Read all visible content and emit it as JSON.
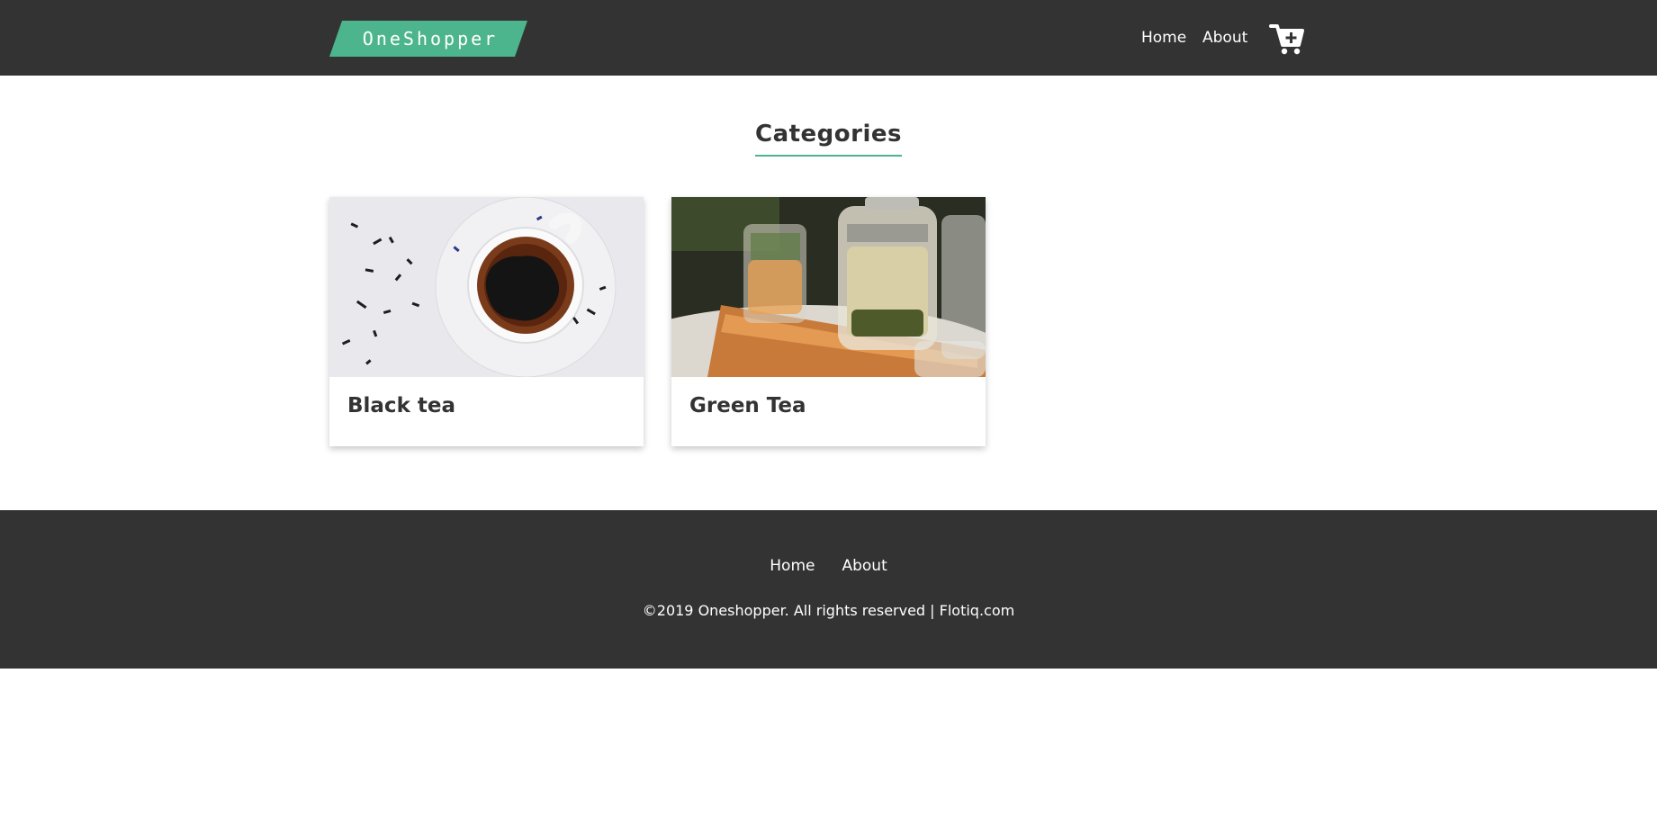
{
  "header": {
    "logo_text": "OneShopper",
    "nav": [
      {
        "label": "Home"
      },
      {
        "label": "About"
      }
    ],
    "cart_icon": "cart-plus-icon",
    "brand_color": "#4cb58d",
    "bar_color": "#333333"
  },
  "main": {
    "section_title": "Categories",
    "categories": [
      {
        "name": "Black tea",
        "image": "black-tea-cup-photo"
      },
      {
        "name": "Green Tea",
        "image": "green-tea-teapot-photo"
      }
    ]
  },
  "footer": {
    "nav": [
      {
        "label": "Home"
      },
      {
        "label": "About"
      }
    ],
    "copyright": "©2019 Oneshopper. All rights reserved | Flotiq.com"
  }
}
